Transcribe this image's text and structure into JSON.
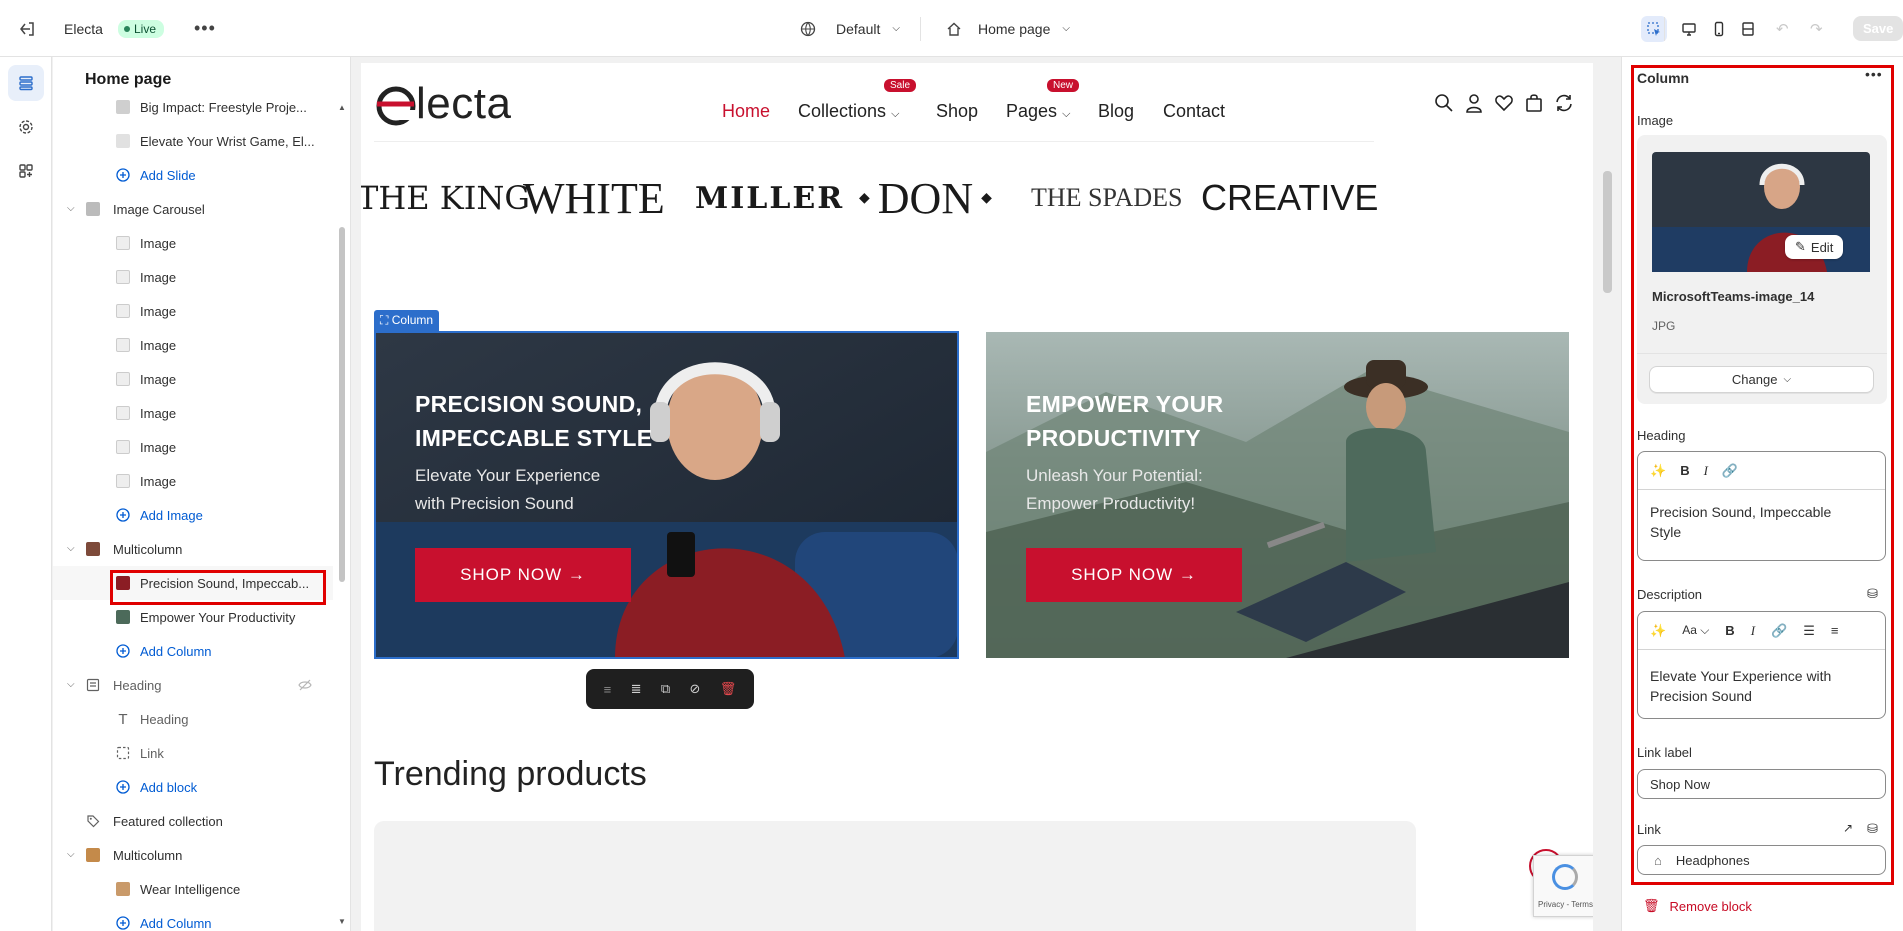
{
  "topbar": {
    "store_name": "Electa",
    "status": "Live",
    "theme": "Default",
    "template": "Home page",
    "save_label": "Save"
  },
  "sidebar": {
    "title": "Home page",
    "items": [
      {
        "label": "Big Impact: Freestyle Proje...",
        "kind": "child"
      },
      {
        "label": "Elevate Your Wrist Game, El...",
        "kind": "child"
      },
      {
        "label": "Add Slide",
        "kind": "add"
      },
      {
        "label": "Image Carousel",
        "kind": "section"
      },
      {
        "label": "Image",
        "kind": "child"
      },
      {
        "label": "Image",
        "kind": "child"
      },
      {
        "label": "Image",
        "kind": "child"
      },
      {
        "label": "Image",
        "kind": "child"
      },
      {
        "label": "Image",
        "kind": "child"
      },
      {
        "label": "Image",
        "kind": "child"
      },
      {
        "label": "Image",
        "kind": "child"
      },
      {
        "label": "Image",
        "kind": "child"
      },
      {
        "label": "Add Image",
        "kind": "add"
      },
      {
        "label": "Multicolumn",
        "kind": "section"
      },
      {
        "label": "Precision Sound, Impeccab...",
        "kind": "child"
      },
      {
        "label": "Empower Your Productivity",
        "kind": "child"
      },
      {
        "label": "Add Column",
        "kind": "add"
      },
      {
        "label": "Heading",
        "kind": "section"
      },
      {
        "label": "Heading",
        "kind": "child"
      },
      {
        "label": "Link",
        "kind": "child"
      },
      {
        "label": "Add block",
        "kind": "add"
      },
      {
        "label": "Featured collection",
        "kind": "section"
      },
      {
        "label": "Multicolumn",
        "kind": "section"
      },
      {
        "label": "Wear Intelligence",
        "kind": "child"
      },
      {
        "label": "Add Column",
        "kind": "add"
      }
    ]
  },
  "preview": {
    "logo": "electa",
    "nav": [
      "Home",
      "Collections",
      "Shop",
      "Pages",
      "Blog",
      "Contact"
    ],
    "nav_badges": {
      "collections": "Sale",
      "pages": "New"
    },
    "brands": [
      "THE KING",
      "WHITE",
      "MILLER",
      "DON",
      "THE SPADES",
      "CREATIVE"
    ],
    "column_tag": "Column",
    "promo_1": {
      "heading_line1": "PRECISION SOUND,",
      "heading_line2": "IMPECCABLE STYLE",
      "desc_line1": "Elevate Your Experience",
      "desc_line2": "with Precision Sound",
      "button": "SHOP NOW →"
    },
    "promo_2": {
      "heading_line1": "EMPOWER YOUR",
      "heading_line2": "PRODUCTIVITY",
      "desc_line1": "Unleash Your Potential:",
      "desc_line2": "Empower Productivity!",
      "button": "SHOP NOW →"
    },
    "trending_title": "Trending products",
    "recaptcha_text": "Privacy - Terms"
  },
  "panel": {
    "title": "Column",
    "image_label": "Image",
    "image_name": "MicrosoftTeams-image_14",
    "image_type": "JPG",
    "edit_label": "Edit",
    "change_label": "Change",
    "heading_label": "Heading",
    "heading_value": "Precision Sound, Impeccable Style",
    "description_label": "Description",
    "description_value": "Elevate Your Experience with Precision Sound",
    "link_label_label": "Link label",
    "link_label_value": "Shop Now",
    "link_label": "Link",
    "link_value": "Headphones",
    "remove_label": "Remove block"
  },
  "colors": {
    "brand_red": "#c8102e",
    "selection_blue": "#2c6ecb",
    "highlight_red": "#e00000"
  }
}
